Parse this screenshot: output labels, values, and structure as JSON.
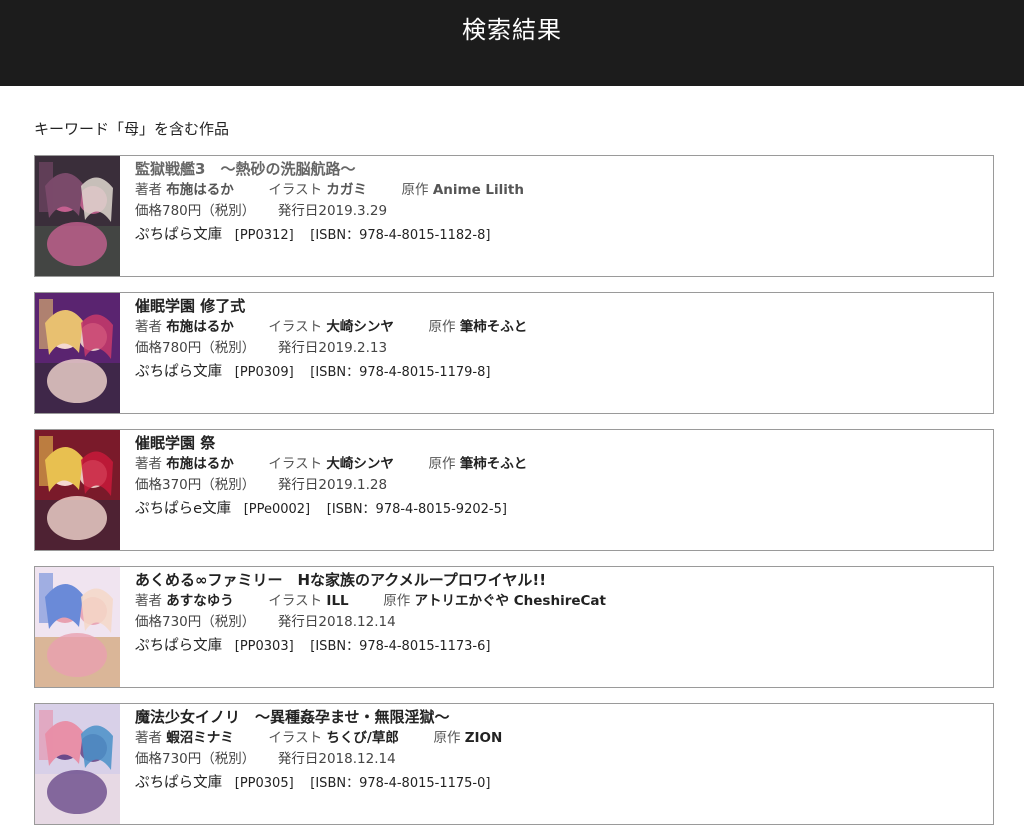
{
  "header": {
    "title": "検索結果"
  },
  "search": {
    "caption": "キーワード「母」を含む作品"
  },
  "labels": {
    "author": "著者",
    "illust": "イラスト",
    "original": "原作"
  },
  "books": [
    {
      "title": "監獄戦艦3　〜熱砂の洗脳航路〜",
      "author": "布施はるか",
      "illust": "カガミ",
      "original": "Anime Lilith",
      "price": "価格780円（税別）",
      "release": "発行日2019.3.29",
      "library": "ぷちぱら文庫",
      "code": "[PP0312]",
      "isbn": "[ISBN：978-4-8015-1182-8]",
      "cover_colors": [
        "#3a2e3a",
        "#7a4a6a",
        "#c46090",
        "#4a5a4a",
        "#e0d8d0"
      ]
    },
    {
      "title": "催眠学園 修了式",
      "author": "布施はるか",
      "illust": "大崎シンヤ",
      "original": "筆柿そふと",
      "price": "価格780円（税別）",
      "release": "発行日2019.2.13",
      "library": "ぷちぱら文庫",
      "code": "[PP0309]",
      "isbn": "[ISBN：978-4-8015-1179-8]",
      "cover_colors": [
        "#5a2470",
        "#e8c070",
        "#f4d8d0",
        "#2a2a2a",
        "#c83a6a"
      ]
    },
    {
      "title": "催眠学園 祭",
      "author": "布施はるか",
      "illust": "大崎シンヤ",
      "original": "筆柿そふと",
      "price": "価格370円（税別）",
      "release": "発行日2019.1.28",
      "library": "ぷちぱらe文庫",
      "code": "[PPe0002]",
      "isbn": "[ISBN：978-4-8015-9202-5]",
      "cover_colors": [
        "#7a1a2a",
        "#e8c050",
        "#f4d8d0",
        "#2a2a3a",
        "#c81a3a"
      ]
    },
    {
      "title": "あくめる∞ファミリー　Hな家族のアクメループロワイヤル!!",
      "author": "あすなゆう",
      "illust": "ILL",
      "original": "アトリエかぐや CheshireCat",
      "price": "価格730円（税別）",
      "release": "発行日2018.12.14",
      "library": "ぷちぱら文庫",
      "code": "[PP0303]",
      "isbn": "[ISBN：978-4-8015-1173-6]",
      "cover_colors": [
        "#f0e4f0",
        "#6a8ad8",
        "#e8a0b0",
        "#c89050",
        "#f4d8c8"
      ]
    },
    {
      "title": "魔法少女イノリ　〜異種姦孕ませ・無限淫獄〜",
      "author": "蝦沼ミナミ",
      "illust": "ちくび/草郎",
      "original": "ZION",
      "price": "価格730円（税別）",
      "release": "発行日2018.12.14",
      "library": "ぷちぱら文庫",
      "code": "[PP0305]",
      "isbn": "[ISBN：978-4-8015-1175-0]",
      "cover_colors": [
        "#d8d0e8",
        "#e890a8",
        "#6a4a8a",
        "#f4e0e0",
        "#4a90c8"
      ]
    }
  ]
}
